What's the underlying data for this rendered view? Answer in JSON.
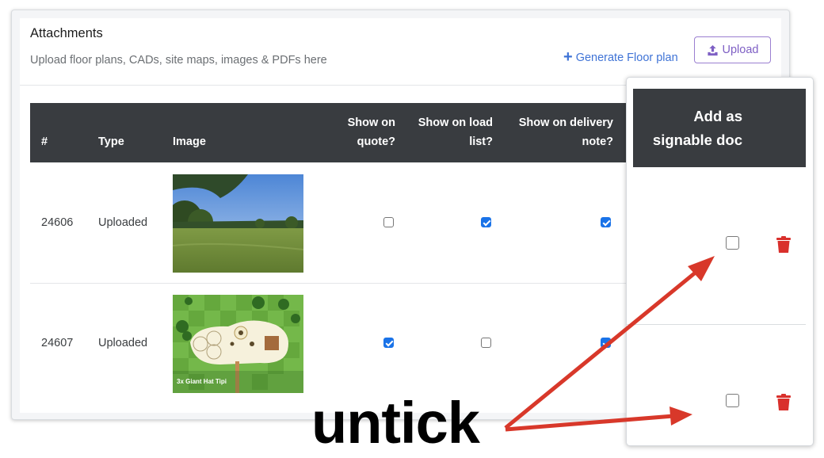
{
  "attachments": {
    "title": "Attachments",
    "subtitle": "Upload floor plans, CADs, site maps, images & PDFs here",
    "generate_link": "Generate Floor plan",
    "upload_button": "Upload"
  },
  "table": {
    "headers": {
      "num": "#",
      "type": "Type",
      "image": "Image",
      "quote_line1": "Show on",
      "quote_line2": "quote?",
      "load_line1": "Show on load",
      "load_line2": "list?",
      "delivery_line1": "Show on delivery",
      "delivery_line2": "note?"
    },
    "rows": [
      {
        "id": "24606",
        "type": "Uploaded",
        "image": "field-photo",
        "show_on_quote": false,
        "show_on_load_list": true,
        "show_on_delivery_note": true,
        "signable": false
      },
      {
        "id": "24607",
        "type": "Uploaded",
        "image": "floor-plan",
        "image_caption": "3x Giant Hat Tipi",
        "show_on_quote": true,
        "show_on_load_list": false,
        "show_on_delivery_note": true,
        "signable": false
      }
    ]
  },
  "signable_panel": {
    "header_line1": "Add as",
    "header_line2": "signable doc"
  },
  "annotation": {
    "text": "untick",
    "arrow_color": "#d8382a"
  },
  "colors": {
    "header_bg": "#393c40",
    "checkbox_checked": "#1a73e8",
    "link": "#3f73d6",
    "upload_accent": "#7e5fc4",
    "trash": "#d9302c"
  }
}
